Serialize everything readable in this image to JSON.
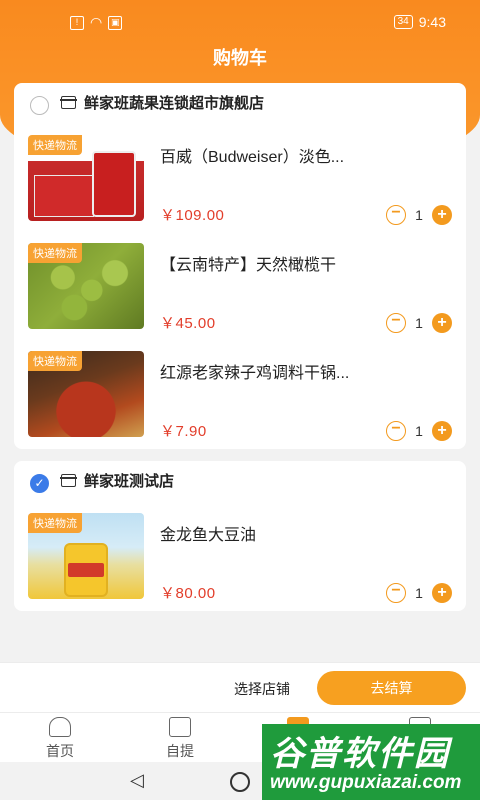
{
  "status_bar": {
    "time": "9:43",
    "battery": "34"
  },
  "header": {
    "title": "购物车"
  },
  "stores": [
    {
      "name": "鲜家班蔬果连锁超市旗舰店",
      "selected": false,
      "products": [
        {
          "tag": "快递物流",
          "name": "百威（Budweiser）淡色...",
          "price": "￥109.00",
          "qty": "1",
          "image": "budweiser-beer"
        },
        {
          "tag": "快递物流",
          "name": "【云南特产】天然橄榄干",
          "price": "￥45.00",
          "qty": "1",
          "image": "olives"
        },
        {
          "tag": "快递物流",
          "name": "红源老家辣子鸡调料干锅...",
          "price": "￥7.90",
          "qty": "1",
          "image": "spicy-chicken-seasoning"
        }
      ]
    },
    {
      "name": "鲜家班测试店",
      "selected": true,
      "products": [
        {
          "tag": "快递物流",
          "name": "金龙鱼大豆油",
          "price": "￥80.00",
          "qty": "1",
          "image": "soybean-oil"
        }
      ]
    }
  ],
  "bottom_bar": {
    "select_store": "选择店铺",
    "checkout": "去结算"
  },
  "tabs": [
    {
      "label": "首页",
      "icon": "home-icon"
    },
    {
      "label": "自提",
      "icon": "pickup-icon"
    },
    {
      "label": "",
      "icon": "cart-icon",
      "active": true
    },
    {
      "label": "",
      "icon": "user-icon"
    }
  ],
  "watermark": {
    "main": "谷普软件园",
    "url": "www.gupuxiazai.com"
  },
  "colors": {
    "primary": "#f98a1f",
    "price": "#e23d2a",
    "checked": "#3b7be8"
  }
}
